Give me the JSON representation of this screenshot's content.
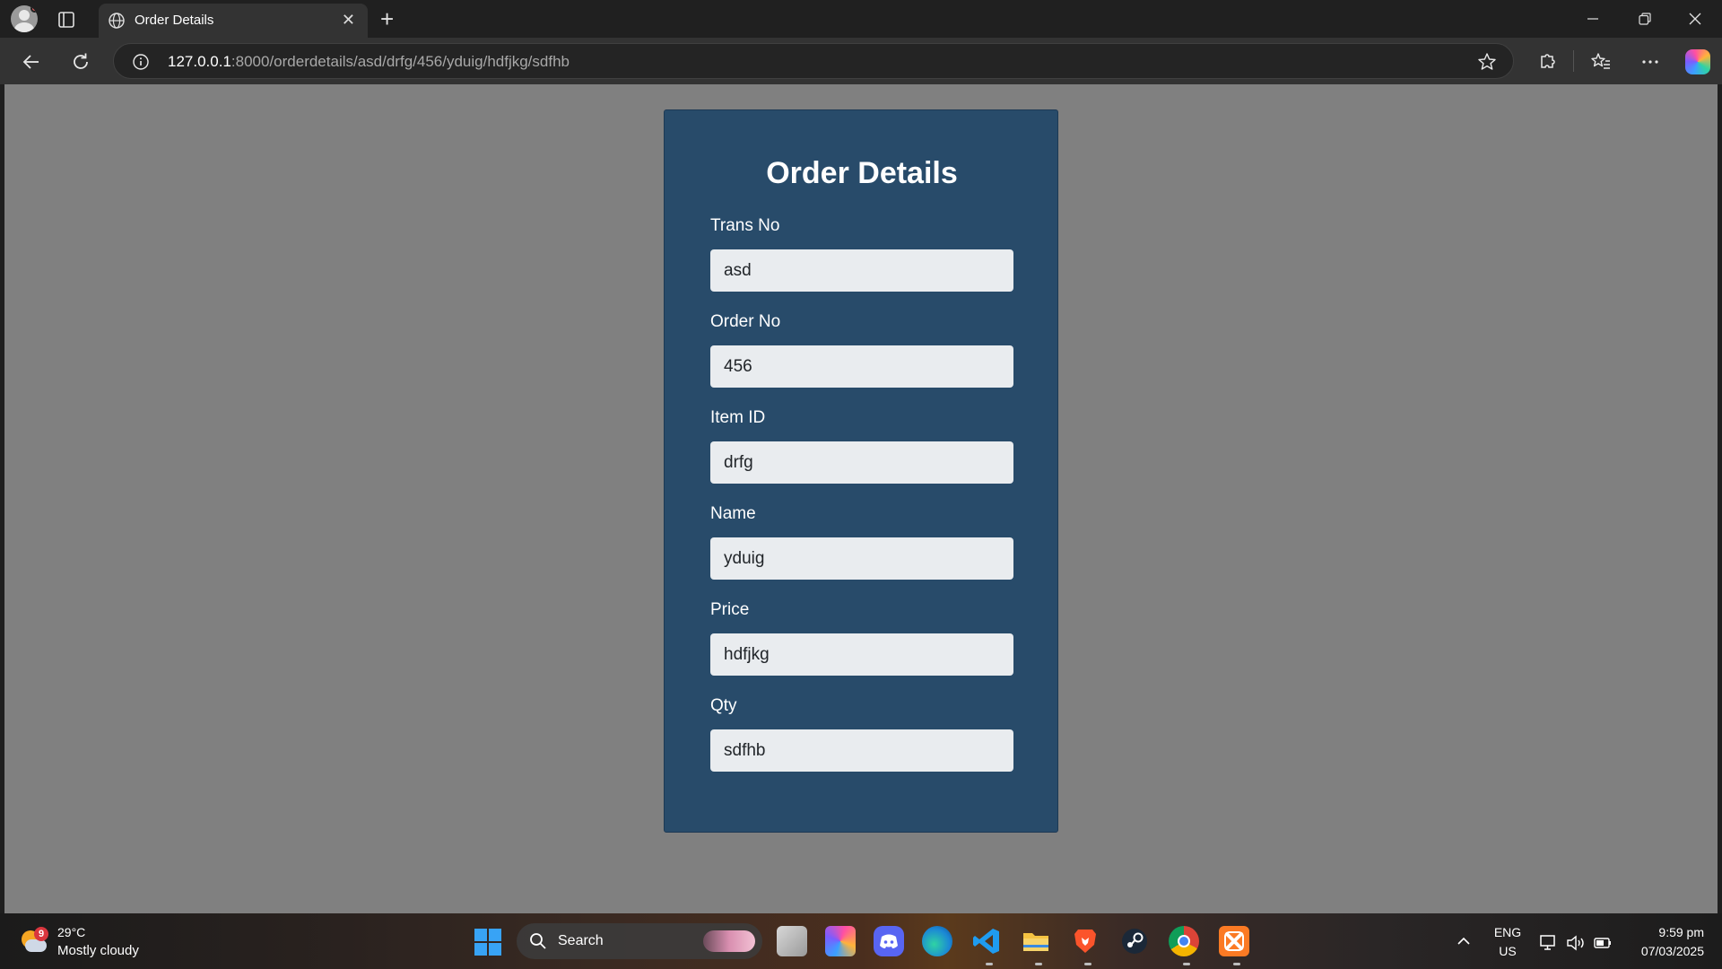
{
  "browser": {
    "tab_title": "Order Details",
    "new_tab_symbol": "+",
    "close_tab_symbol": "✕",
    "url_host": "127.0.0.1",
    "url_rest": ":8000/orderdetails/asd/drfg/456/yduig/hdfjkg/sdfhb"
  },
  "page": {
    "heading": "Order Details",
    "fields": [
      {
        "label": "Trans No",
        "value": "asd"
      },
      {
        "label": "Order No",
        "value": "456"
      },
      {
        "label": "Item ID",
        "value": "drfg"
      },
      {
        "label": "Name",
        "value": "yduig"
      },
      {
        "label": "Price",
        "value": "hdfjkg"
      },
      {
        "label": "Qty",
        "value": "sdfhb"
      }
    ],
    "card_color": "#284b6a",
    "page_background": "#808080"
  },
  "taskbar": {
    "weather_badge": "9",
    "temperature": "29°C",
    "weather_desc": "Mostly cloudy",
    "search_label": "Search",
    "language_1": "ENG",
    "language_2": "US",
    "time": "9:59 pm",
    "date": "07/03/2025",
    "apps": [
      "file-explorer-icon",
      "copilot-icon",
      "discord-icon",
      "edge-icon",
      "vscode-icon",
      "folder-icon",
      "brave-icon",
      "steam-icon",
      "chrome-icon",
      "xampp-icon"
    ]
  }
}
